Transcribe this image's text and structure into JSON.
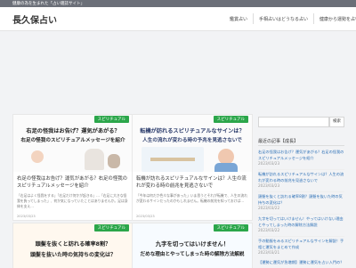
{
  "topbar": {
    "text": "健康の為を生まれた「占い雑誌サイト」"
  },
  "site": {
    "title": "長久保占い"
  },
  "nav": {
    "items": [
      "鑑賞占い",
      "手相占いはどうなる占い",
      "健康から運勢を占い"
    ]
  },
  "colors": {
    "category": "#2ba64a",
    "link": "#2b6fb6",
    "accent_orange": "#ee7a1a"
  },
  "cards": [
    {
      "category": "スピリチュアル",
      "img_line1": "右足の怪我はお告げ？運気があがる？",
      "img_line2": "右足の怪我のスピリチュアルメッセージを紹介",
      "title": "右足の怪我はお告げ？運気があがる？右足の怪我のスピリチュアルメッセージを紹介",
      "excerpt": "「右足はよく怪我をする」「右足だけ何かが起きる」…「右足に大きな怪我を負ってしまった」、何か気になっていたことはありませんか。足は身体を支え…",
      "date": "2023/03/23"
    },
    {
      "category": "スピリチュアル",
      "img_line1": "転機が訪れるスピリチュアルなサインは？",
      "img_line2": "人生の流れが変わる時の予兆を見逃さないで",
      "title": "転機が訪れるスピリチュアルなサインは？人生の流れが変わる時の前兆を見逃さないで",
      "excerpt": "「今年は何だか色々な事があった」いま思うとそれが転機で、人生の流れが変わるサインだったのかもしれません。転機の前兆を知っておけば…",
      "date": "2023/03/23"
    },
    {
      "category": "スピリチュアル",
      "img_line1": "頭髪を抜くと訪れる確率8割？",
      "img_line2": "頭髪を抜いた時の気持ちの変化は？",
      "title": "",
      "excerpt": "",
      "date": ""
    },
    {
      "category": "スピリチュアル",
      "img_line1": "九字を切ってはいけません！",
      "img_line2": "だめな理由とやってしまった時の解除方法解説",
      "title": "",
      "excerpt": "",
      "date": ""
    }
  ],
  "sidebar": {
    "search_button": "検索",
    "recent_heading": "最近の記事【成長】",
    "recent_items": [
      {
        "text": "右足の怪我はお告げ？運気があがる？右足の怪我のスピリチュアルメッセージを紹介",
        "date": "2023/03/23"
      },
      {
        "text": "転機が訪れるスピリチュアルなサインは？人生の流れが変わる時の前兆を見逃さないで",
        "date": "2023/03/23"
      },
      {
        "text": "頭髪を抜くと訪れる確率8割？頭髪を抜いた時の気持ちの変化は？",
        "date": "2023/03/22"
      },
      {
        "text": "九字を切ってはいけません！やってはいけない理由とやってしまった時の解除方法解説",
        "date": "2023/03/22"
      },
      {
        "text": "手の動脈をみるスピリチュアルなサインを解説！手相と運気をまとめて作成",
        "date": "2023/03/21"
      }
    ],
    "last_item": "【運勢に運気が急増期】運勢に運気を占い入門の？"
  }
}
